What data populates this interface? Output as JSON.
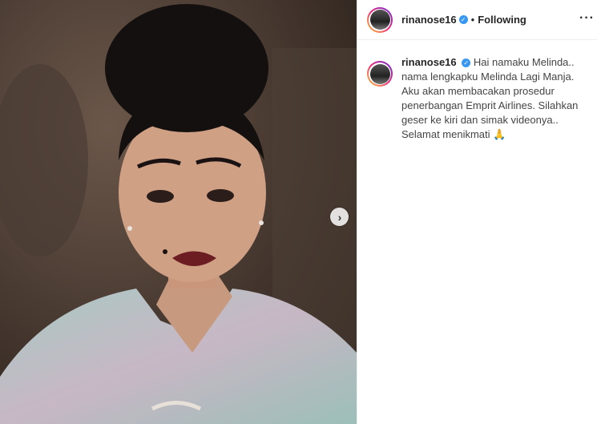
{
  "post": {
    "username": "rinanose16",
    "verified_icon": "verified-badge-icon",
    "separator": "•",
    "follow_status": "Following",
    "more_icon": "more-options-icon",
    "more_label": "···",
    "next_label": "›",
    "caption": "Hai namaku Melinda.. nama lengkapku Melinda Lagi Manja. Aku akan membacakan prosedur penerbangan Emprit Airlines. Silahkan geser ke kiri dan simak videonya.. Selamat menikmati 🙏"
  },
  "colors": {
    "accent": "#3897f0",
    "text": "#262626",
    "border": "#efefef"
  }
}
